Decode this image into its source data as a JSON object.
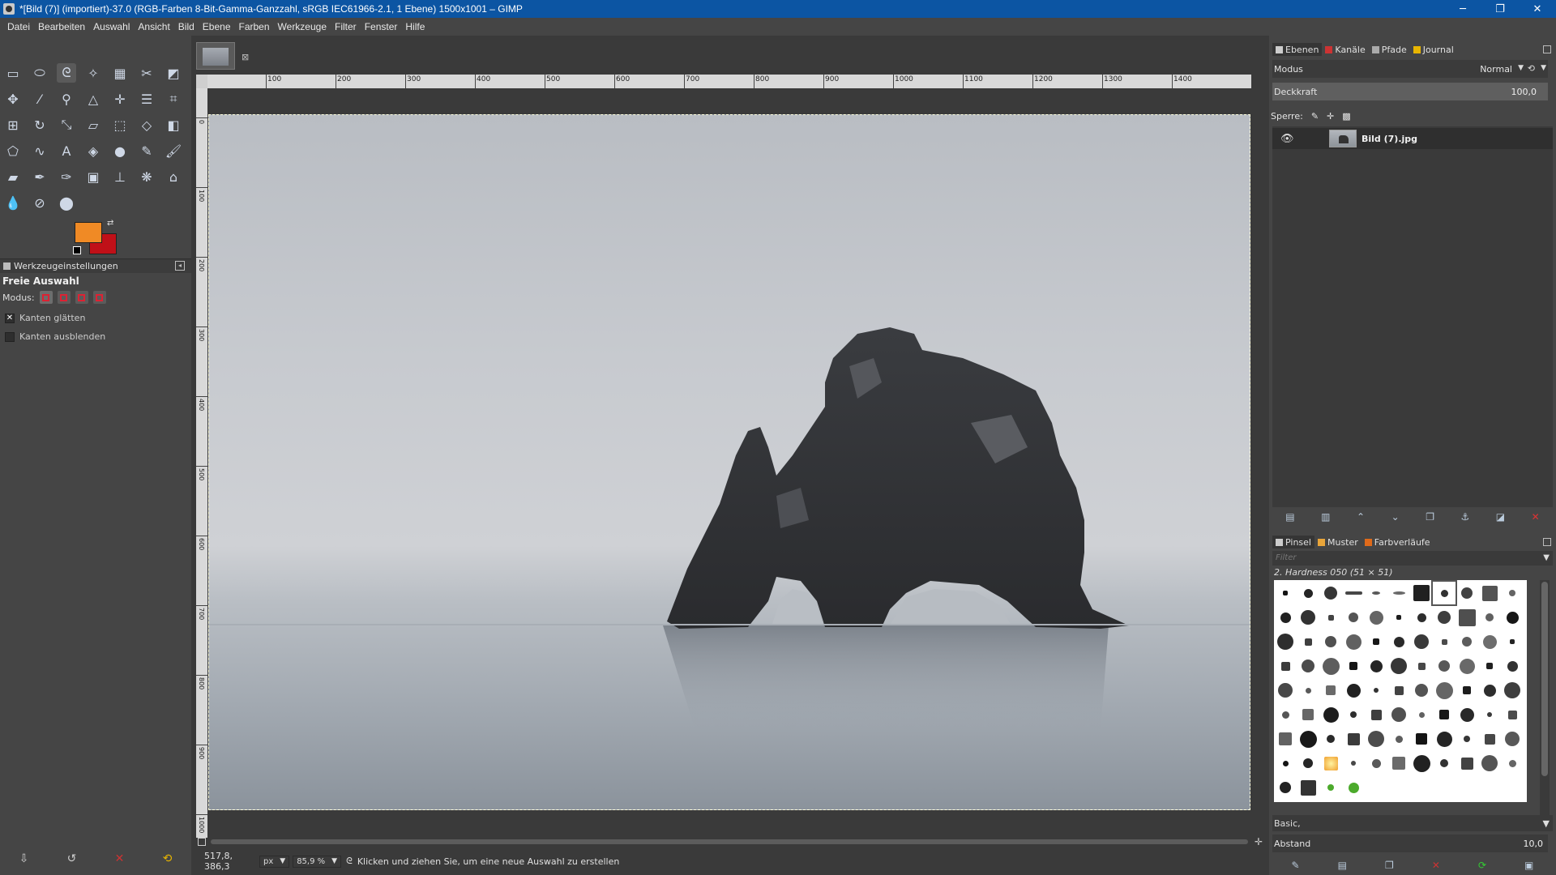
{
  "window": {
    "title": "*[Bild (7)] (importiert)-37.0 (RGB-Farben 8-Bit-Gamma-Ganzzahl, sRGB IEC61966-2.1, 1 Ebene) 1500x1001 – GIMP",
    "minimize": "─",
    "maximize": "❐",
    "close": "✕"
  },
  "menu": [
    "Datei",
    "Bearbeiten",
    "Auswahl",
    "Ansicht",
    "Bild",
    "Ebene",
    "Farben",
    "Werkzeuge",
    "Filter",
    "Fenster",
    "Hilfe"
  ],
  "tool_options": {
    "tab_label": "Werkzeugeinstellungen",
    "title": "Freie Auswahl",
    "modus_label": "Modus:",
    "antialias_label": "Kanten glätten",
    "antialias_checked": true,
    "feather_label": "Kanten ausblenden",
    "feather_checked": false
  },
  "colors": {
    "foreground": "#f08a25",
    "background": "#c01018"
  },
  "ruler": {
    "h_labels": [
      "100",
      "200",
      "300",
      "400",
      "500",
      "600",
      "700",
      "800",
      "900",
      "1000",
      "1100",
      "1200",
      "1300",
      "1400"
    ],
    "v_labels": [
      "0",
      "100",
      "200",
      "300",
      "400",
      "500",
      "600",
      "700",
      "800",
      "900",
      "1000"
    ]
  },
  "status": {
    "coords": "517,8, 386,3",
    "unit": "px",
    "zoom": "85,9 %",
    "message": "Klicken und ziehen Sie, um eine neue Auswahl zu erstellen"
  },
  "layers_dock": {
    "tabs": [
      "Ebenen",
      "Kanäle",
      "Pfade",
      "Journal"
    ],
    "modus_label": "Modus",
    "modus_value": "Normal",
    "opacity_label": "Deckkraft",
    "opacity_value": "100,0",
    "lock_label": "Sperre:",
    "layers": [
      {
        "name": "Bild (7).jpg"
      }
    ]
  },
  "brushes_dock": {
    "tabs": [
      "Pinsel",
      "Muster",
      "Farbverläufe"
    ],
    "filter_placeholder": "Filter",
    "selected_brush": "2. Hardness 050 (51 × 51)",
    "preset": "Basic,",
    "spacing_label": "Abstand",
    "spacing_value": "10,0"
  }
}
